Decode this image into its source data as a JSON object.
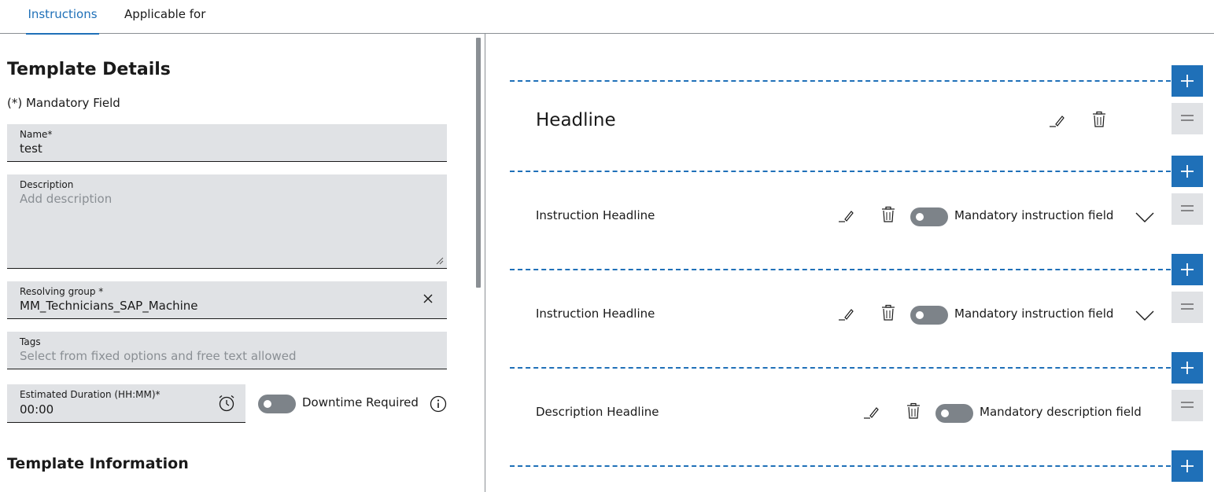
{
  "tabs": [
    {
      "label": "Instructions",
      "active": true
    },
    {
      "label": "Applicable for",
      "active": false
    }
  ],
  "details": {
    "title": "Template Details",
    "mandatory_note": "(*) Mandatory Field",
    "name": {
      "label": "Name*",
      "value": "test"
    },
    "description": {
      "label": "Description",
      "placeholder": "Add description"
    },
    "resolving_group": {
      "label": "Resolving group *",
      "value": "MM_Technicians_SAP_Machine"
    },
    "tags": {
      "label": "Tags",
      "placeholder": "Select from fixed options and free text allowed"
    },
    "duration": {
      "label": "Estimated Duration (HH:MM)*",
      "value": "00:00"
    },
    "downtime": {
      "label": "Downtime Required",
      "checked": false
    }
  },
  "information": {
    "title": "Template Information"
  },
  "blocks": [
    {
      "type": "headline",
      "title": "Headline"
    },
    {
      "type": "instruction",
      "title": "Instruction Headline",
      "toggle_label": "Mandatory instruction field",
      "checked": false
    },
    {
      "type": "instruction",
      "title": "Instruction Headline",
      "toggle_label": "Mandatory instruction field",
      "checked": false
    },
    {
      "type": "description",
      "title": "Description Headline",
      "toggle_label": "Mandatory description field",
      "checked": false
    }
  ],
  "colors": {
    "accent": "#1f70b8",
    "field_bg": "#e0e2e5",
    "toggle_off": "#7d8389"
  },
  "icons": [
    "clear-icon",
    "clock-icon",
    "info-icon",
    "edit-icon",
    "trash-icon",
    "chevron-down-icon",
    "plus-icon",
    "drag-handle-icon"
  ]
}
